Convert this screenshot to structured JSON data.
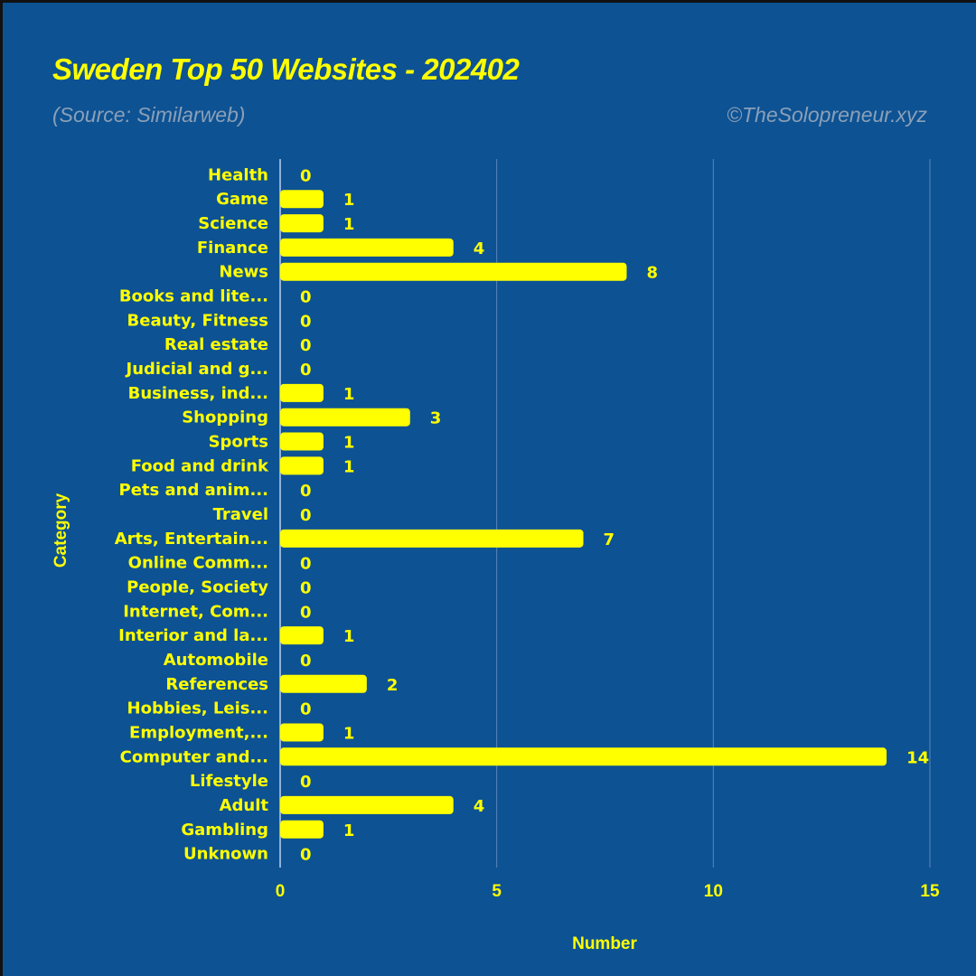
{
  "header": {
    "title": "Sweden Top 50 Websites - 202402",
    "subtitle": "(Source: Similarweb)",
    "credit": "©TheSolopreneur.xyz"
  },
  "colors": {
    "background": "#0d5293",
    "bar": "#ffff00",
    "text": "#ffff00",
    "muted_text": "#8aa0b8",
    "grid": "#5b86b8"
  },
  "chart_data": {
    "type": "bar",
    "orientation": "horizontal",
    "title": "Sweden Top 50 Websites - 202402",
    "subtitle": "(Source: Similarweb)",
    "xlabel": "Number",
    "ylabel": "Category",
    "xlim": [
      0,
      15
    ],
    "xticks": [
      0,
      5,
      10,
      15
    ],
    "grid": true,
    "categories": [
      "Health",
      "Game",
      "Science",
      "Finance",
      "News",
      "Books and lite...",
      "Beauty, Fitness",
      "Real estate",
      "Judicial and g...",
      "Business, ind...",
      "Shopping",
      "Sports",
      "Food and drink",
      "Pets and anim...",
      "Travel",
      "Arts, Entertain...",
      "Online Comm...",
      "People, Society",
      "Internet, Com...",
      "Interior and la...",
      "Automobile",
      "References",
      "Hobbies, Leis...",
      "Employment,...",
      "Computer and...",
      "Lifestyle",
      "Adult",
      "Gambling",
      "Unknown"
    ],
    "values": [
      0,
      1,
      1,
      4,
      8,
      0,
      0,
      0,
      0,
      1,
      3,
      1,
      1,
      0,
      0,
      7,
      0,
      0,
      0,
      1,
      0,
      2,
      0,
      1,
      14,
      0,
      4,
      1,
      0
    ]
  }
}
